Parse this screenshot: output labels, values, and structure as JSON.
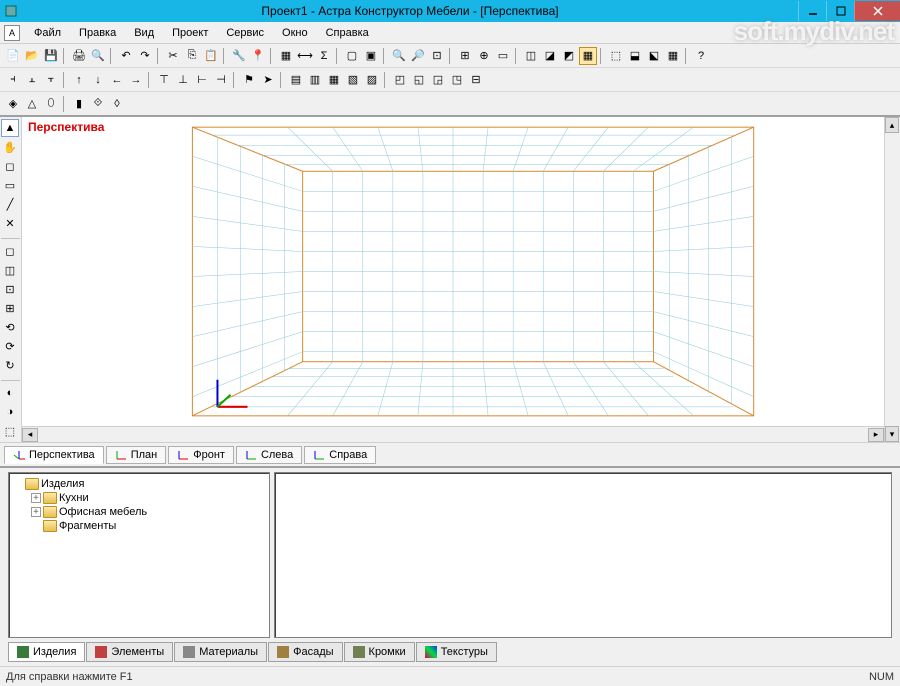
{
  "window": {
    "title": "Проект1 - Астра Конструктор Мебели - [Перспектива]",
    "minimize": "_",
    "maximize": "❐",
    "close": "✕"
  },
  "menu": {
    "file": "Файл",
    "edit": "Правка",
    "view": "Вид",
    "project": "Проект",
    "service": "Сервис",
    "window": "Окно",
    "help": "Справка"
  },
  "viewport": {
    "label": "Перспектива"
  },
  "view_tabs": {
    "perspective": "Перспектива",
    "plan": "План",
    "front": "Фронт",
    "left": "Слева",
    "right": "Справа"
  },
  "tree": {
    "root": "Изделия",
    "items": [
      "Кухни",
      "Офисная мебель",
      "Фрагменты"
    ]
  },
  "bottom_tabs": {
    "products": "Изделия",
    "elements": "Элементы",
    "materials": "Материалы",
    "facades": "Фасады",
    "edges": "Кромки",
    "textures": "Текстуры"
  },
  "status": {
    "help": "Для справки нажмите F1",
    "num": "NUM"
  },
  "watermark": "soft.mydiv.net"
}
